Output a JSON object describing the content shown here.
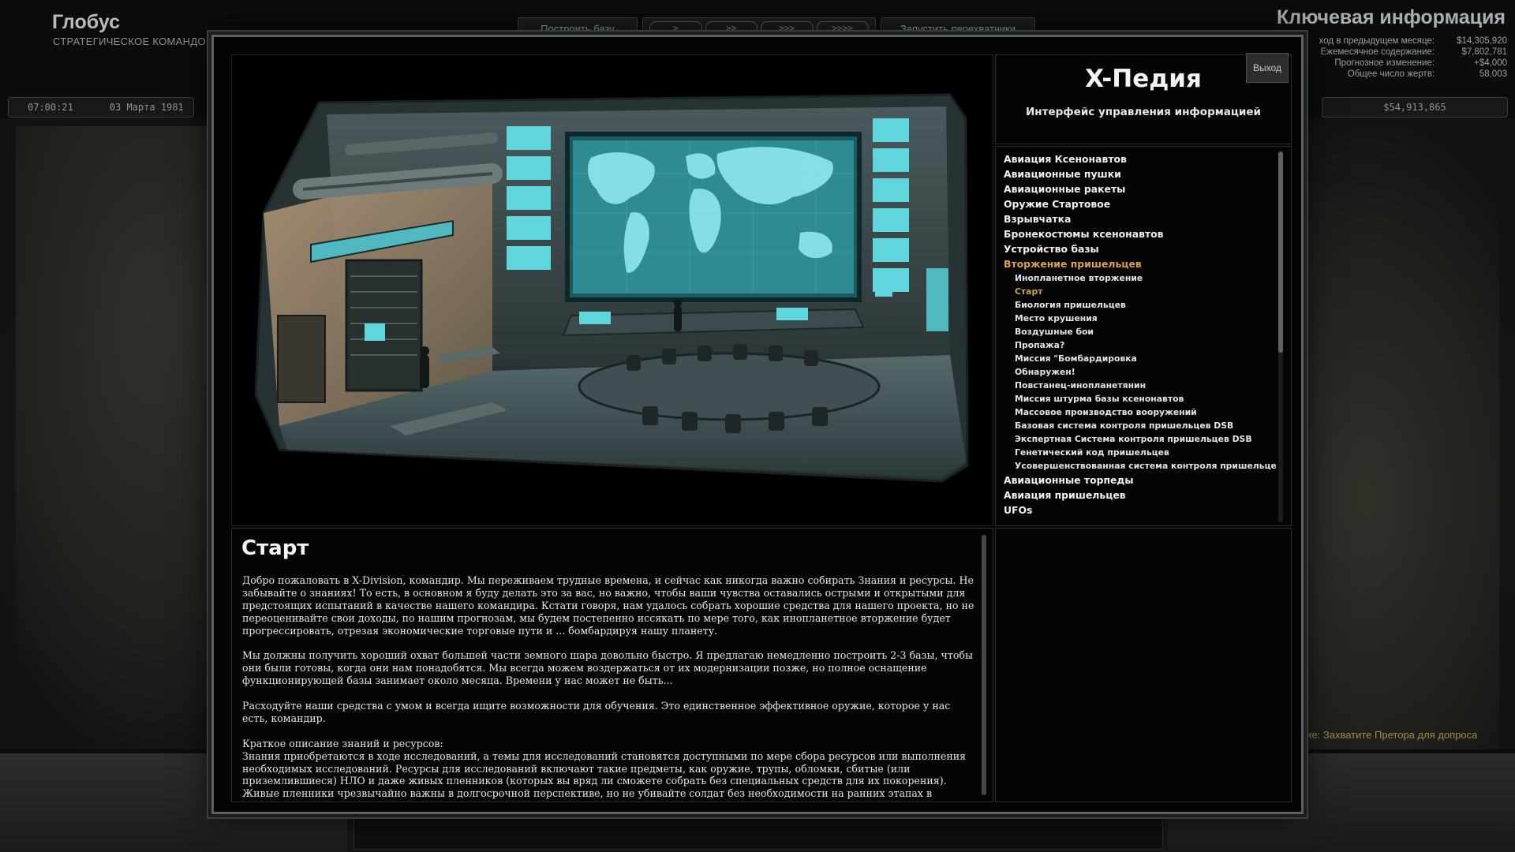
{
  "hud": {
    "title": "Глобус",
    "subtitle": "СТРАТЕГИЧЕСКОЕ КОМАНДОВА",
    "build_base": "Построить базу",
    "speeds": [
      ">",
      ">>",
      ">>>",
      ">>>>"
    ],
    "launch_interceptors": "Запустить перехватчики",
    "time": "07:00:21",
    "date": "03 Марта 1981",
    "info_title": "Ключевая информация",
    "info_rows": [
      {
        "label": "ход в предыдущем месяце:",
        "value": "$14,305,920"
      },
      {
        "label": "Ежемесячное содержание:",
        "value": "$7,802,781"
      },
      {
        "label": "Прогнозное изменение:",
        "value": "+$4,000"
      },
      {
        "label": "Общее число жертв:",
        "value": "58,003"
      }
    ],
    "funds": "$54,913,865",
    "objective": "ние: Захватите Претора для допроса"
  },
  "pedia": {
    "title": "X-Педия",
    "subtitle": "Интерфейс управления информацией",
    "exit": "Выход",
    "categories_top": [
      "Авиация Ксенонавтов",
      "Авиационные пушки",
      "Авиационные ракеты",
      "Оружие Стартовое",
      "Взрывчатка",
      "Бронекостюмы ксенонавтов",
      "Устройство базы"
    ],
    "active_category": "Вторжение пришельцев",
    "subitems": [
      "Инопланетное вторжение",
      "Старт",
      "Биология пришельцев",
      "Место крушения",
      "Воздушные бои",
      "Пропажа?",
      "Миссия \"Бомбардировка",
      "Обнаружен!",
      "Повстанец-инопланетянин",
      "Миссия штурма базы ксенонавтов",
      "Массовое производство вооружений",
      "Базовая система контроля пришельцев DSB",
      "Экспертная Система контроля пришельцев DSB",
      "Генетический код пришельцев",
      "Усовершенствованная система контроля пришельцев DSB"
    ],
    "active_subitem": "Старт",
    "categories_bottom": [
      "Авиационные торпеды",
      "Авиация пришельцев",
      "UFOs"
    ]
  },
  "article": {
    "title": "Старт",
    "paragraphs": [
      "Добро пожаловать в X-Division, командир. Мы переживаем трудные времена, и сейчас как никогда важно собирать Знания и ресурсы. Не забывайте о знаниях! То есть, в основном я буду делать это за вас, но важно, чтобы ваши чувства оставались острыми и открытыми для предстоящих испытаний в качестве нашего командира. Кстати говоря, нам удалось собрать хорошие средства для нашего проекта, но не переоценивайте свои доходы, по нашим прогнозам, мы будем постепенно иссякать по мере того, как инопланетное вторжение будет прогрессировать, отрезая экономические торговые пути и ... бомбардируя нашу планету.",
      "Мы должны получить хороший охват большей части земного шара довольно быстро. Я предлагаю немедленно построить 2-3 базы, чтобы они были готовы, когда они нам понадобятся. Мы всегда можем воздержаться от их модернизации позже, но полное оснащение функционирующей базы занимает около месяца. Времени у нас может не быть...",
      "Расходуйте наши средства с умом и всегда ищите возможности для обучения. Это единственное эффективное оружие, которое у нас есть, командир.",
      "Краткое описание знаний и ресурсов:\nЗнания приобретаются в ходе исследований, а темы для исследований становятся доступными по мере сбора ресурсов или выполнения необходимых исследований. Ресурсы для исследований включают такие предметы, как оружие, трупы, обломки, сбитые (или приземлившиеся) НЛО и даже живых пленников (которых вы вряд ли сможете собрать без специальных средств для их покорения).\nЖивые пленники чрезвычайно важны в долгосрочной перспективе, но не убивайте солдат без необходимости на ранних этапах в"
    ]
  },
  "colors": {
    "accent_active": "#d9a24c",
    "screen_cyan": "#5fd6dc",
    "objective": "#a38a44"
  }
}
